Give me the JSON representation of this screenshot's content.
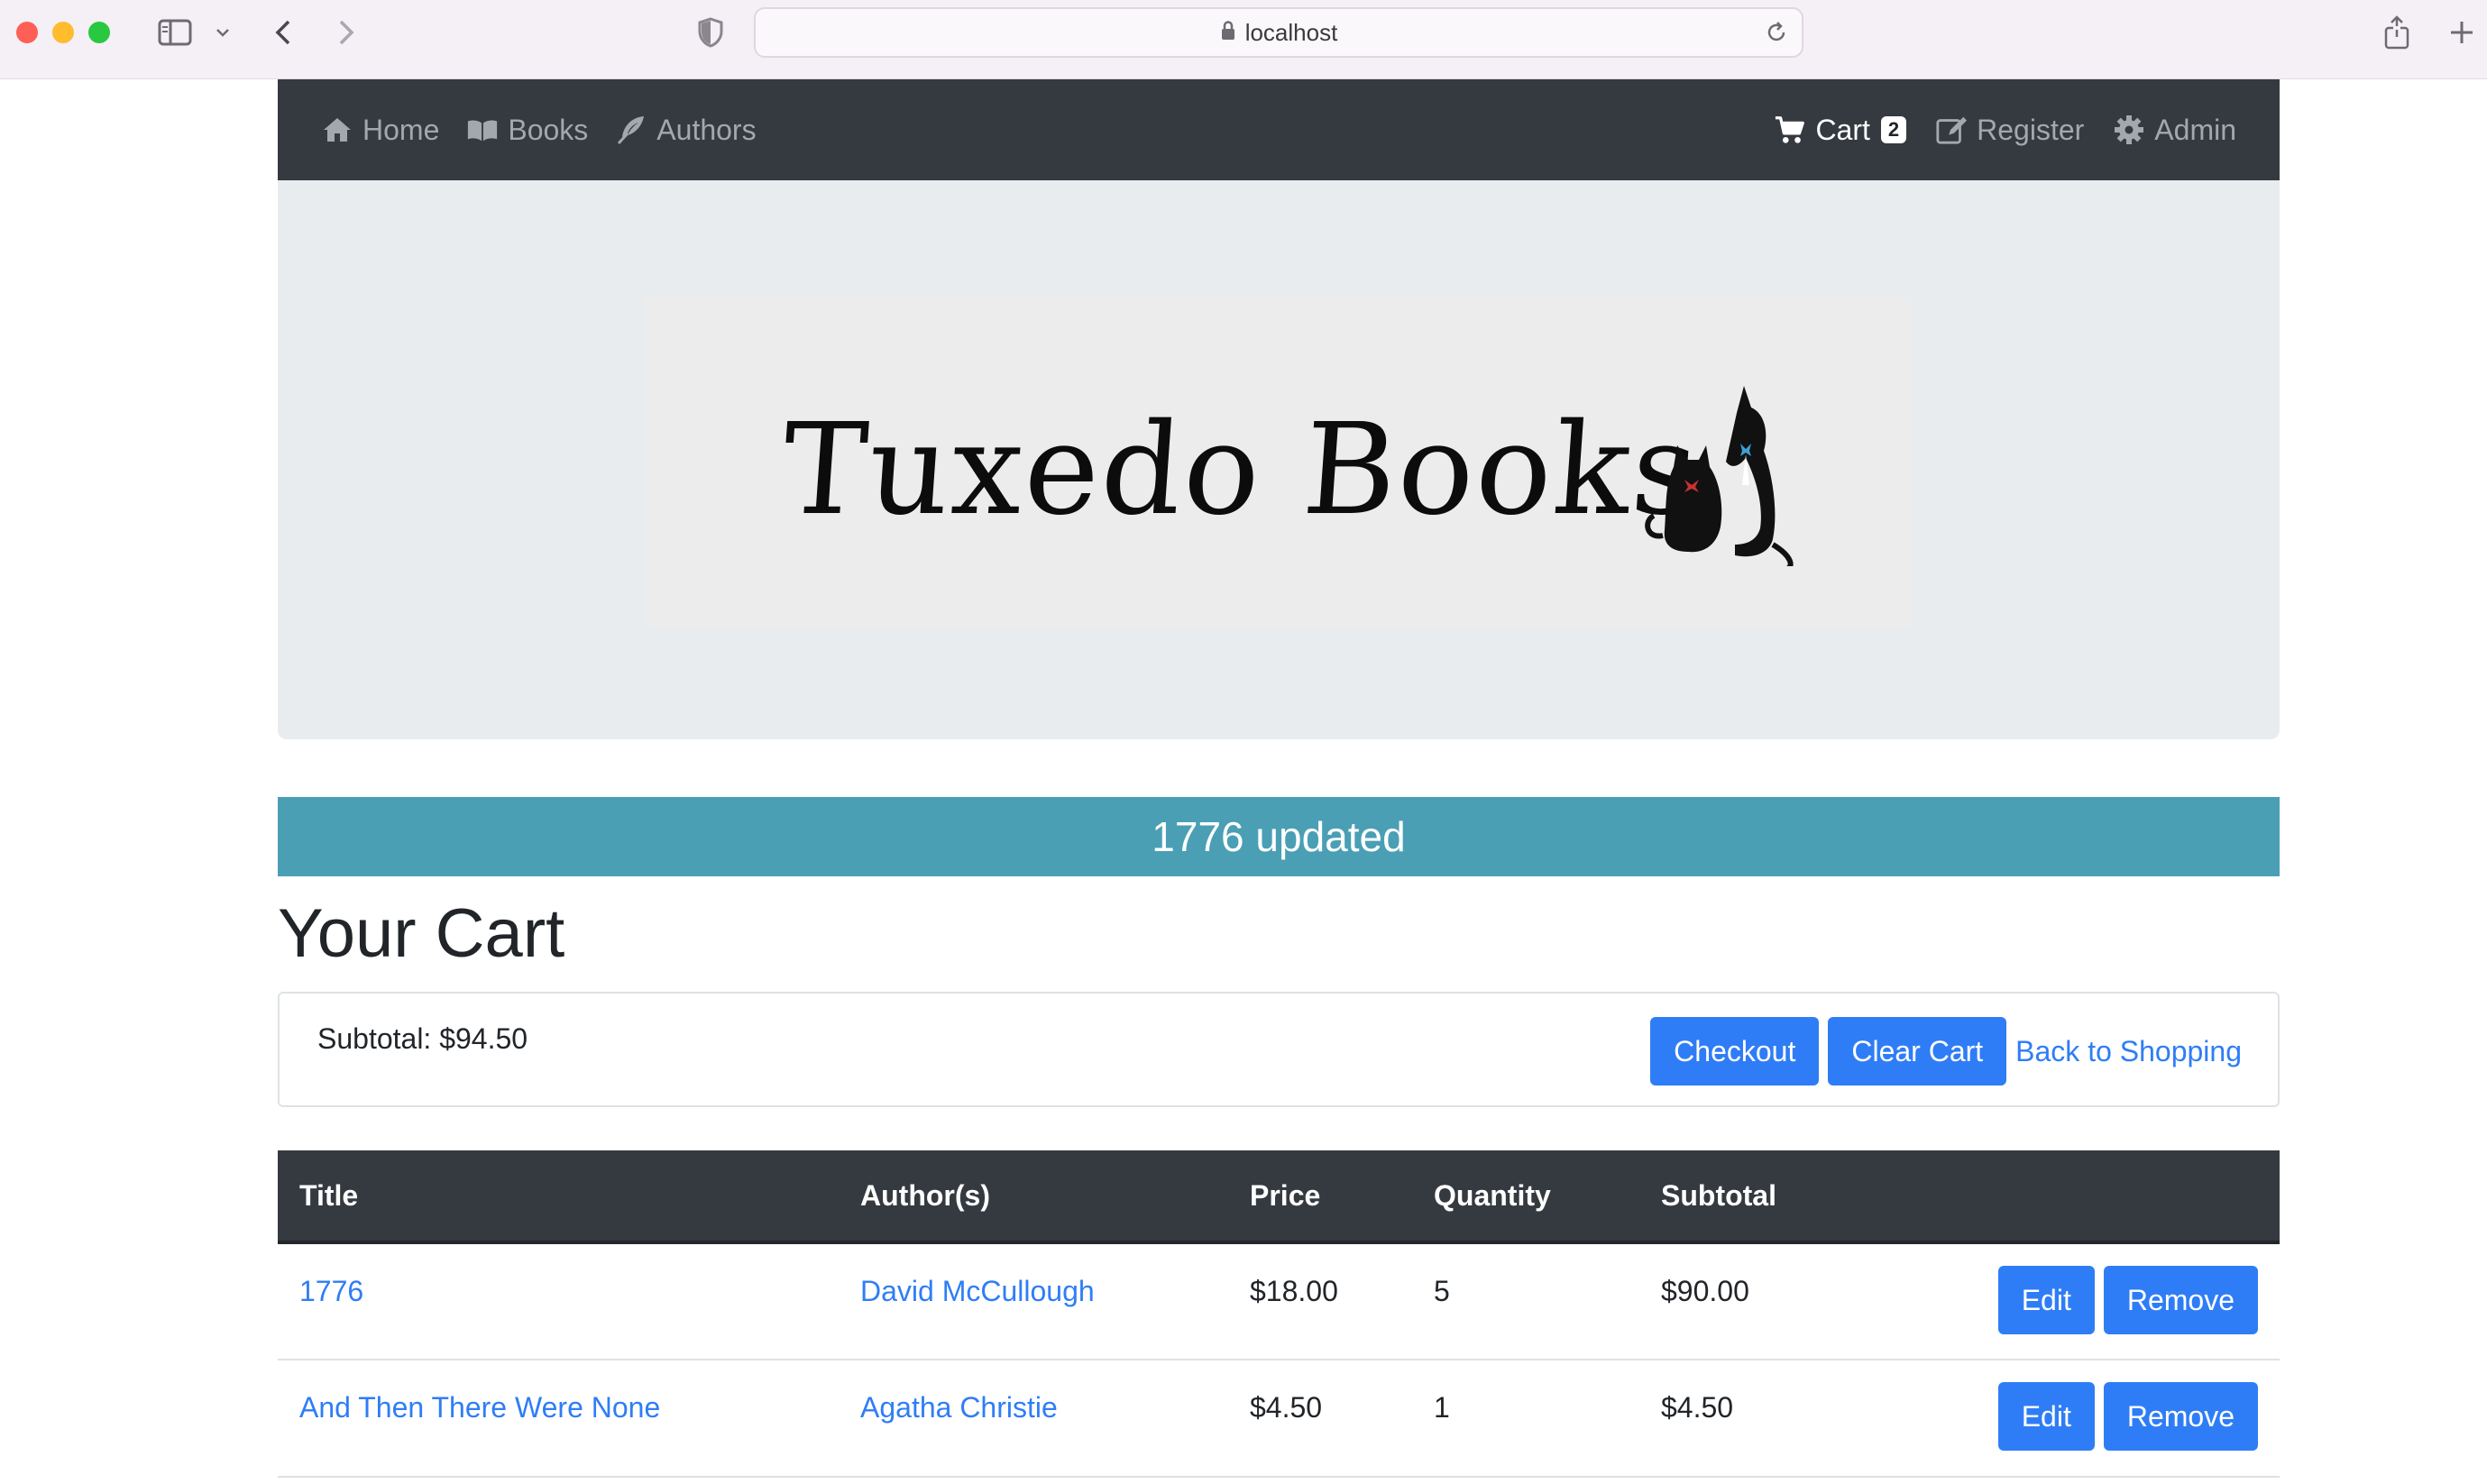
{
  "browser": {
    "url": "localhost"
  },
  "nav": {
    "home": "Home",
    "books": "Books",
    "authors": "Authors",
    "cart": "Cart",
    "cart_count": "2",
    "register": "Register",
    "admin": "Admin"
  },
  "banner": {
    "logo_text": "Tuxedo Books"
  },
  "alert": {
    "message": "1776 updated"
  },
  "page": {
    "title": "Your Cart"
  },
  "summary": {
    "subtotal": "Subtotal: $94.50",
    "checkout_label": "Checkout",
    "clear_label": "Clear Cart",
    "back_label": "Back to Shopping"
  },
  "table": {
    "headers": [
      "Title",
      "Author(s)",
      "Price",
      "Quantity",
      "Subtotal",
      ""
    ],
    "rows": [
      {
        "title": "1776",
        "author": "David McCullough",
        "price": "$18.00",
        "quantity": "5",
        "subtotal": "$90.00",
        "edit": "Edit",
        "remove": "Remove"
      },
      {
        "title": "And Then There Were None",
        "author": "Agatha Christie",
        "price": "$4.50",
        "quantity": "1",
        "subtotal": "$4.50",
        "edit": "Edit",
        "remove": "Remove"
      }
    ]
  },
  "colors": {
    "navbar": "#343a40",
    "primary": "#2f7df6",
    "alert": "#4a9fb5",
    "jumbotron": "#e9ecef"
  }
}
